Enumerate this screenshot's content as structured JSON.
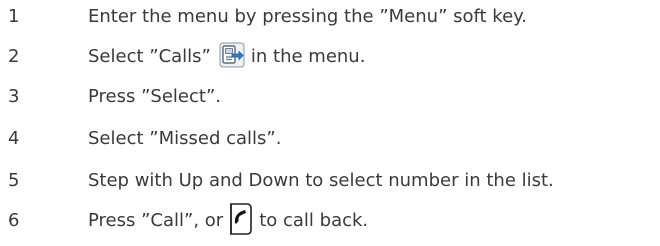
{
  "steps": [
    {
      "number": "1",
      "text": "Enter the menu by pressing the ”Menu” soft key."
    },
    {
      "number": "2",
      "text_before": "Select ”Calls”",
      "text_after": "in the menu.",
      "icon": "calls-icon"
    },
    {
      "number": "3",
      "text": "Press ”Select”."
    },
    {
      "number": "4",
      "text": "Select ”Missed calls”."
    },
    {
      "number": "5",
      "text": "Step with Up and Down to select number in the list."
    },
    {
      "number": "6",
      "text_before": "Press ”Call”, or",
      "text_after": "to call back.",
      "icon": "off-hook-key-icon"
    }
  ]
}
